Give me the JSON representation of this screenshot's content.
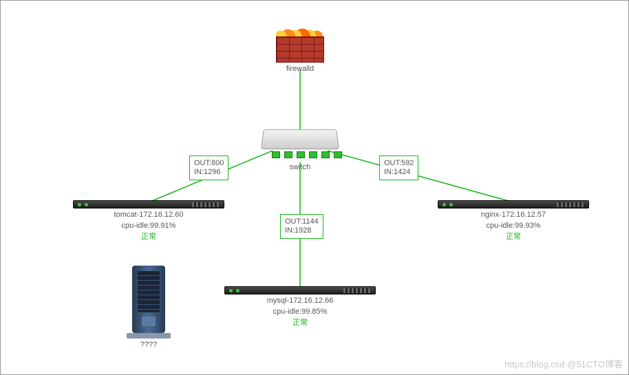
{
  "nodes": {
    "firewall": {
      "label": "firewalld"
    },
    "switch": {
      "label": "switch"
    },
    "tomcat": {
      "title": "tomcat-172.16.12.60",
      "cpu": "cpu-idle:99.91%",
      "status": "正常"
    },
    "nginx": {
      "title": "nginx-172.16.12.57",
      "cpu": "cpu-idle:99.93%",
      "status": "正常"
    },
    "mysql": {
      "title": "mysql-172.16.12.66",
      "cpu": "cpu-idle:99.85%",
      "status": "正常"
    },
    "unknown": {
      "label": "????"
    }
  },
  "links": {
    "sw_tomcat": {
      "out": "OUT:800",
      "in": "IN:1296"
    },
    "sw_nginx": {
      "out": "OUT:592",
      "in": "IN:1424"
    },
    "sw_mysql": {
      "out": "OUT:1144",
      "in": "IN:1928"
    }
  },
  "watermark": "https://blog.csd @51CTO博客",
  "chart_data": {
    "type": "diagram",
    "title": "",
    "nodes": [
      {
        "id": "firewalld",
        "type": "firewall",
        "label": "firewalld"
      },
      {
        "id": "switch",
        "type": "switch",
        "label": "switch"
      },
      {
        "id": "tomcat",
        "type": "server",
        "label": "tomcat-172.16.12.60",
        "cpu_idle_pct": 99.91,
        "status": "正常"
      },
      {
        "id": "nginx",
        "type": "server",
        "label": "nginx-172.16.12.57",
        "cpu_idle_pct": 99.93,
        "status": "正常"
      },
      {
        "id": "mysql",
        "type": "server",
        "label": "mysql-172.16.12.66",
        "cpu_idle_pct": 99.85,
        "status": "正常"
      },
      {
        "id": "unknown",
        "type": "server-tower",
        "label": "????"
      }
    ],
    "edges": [
      {
        "from": "firewalld",
        "to": "switch"
      },
      {
        "from": "switch",
        "to": "tomcat",
        "out": 800,
        "in": 1296
      },
      {
        "from": "switch",
        "to": "nginx",
        "out": 592,
        "in": 1424
      },
      {
        "from": "switch",
        "to": "mysql",
        "out": 1144,
        "in": 1928
      }
    ]
  }
}
